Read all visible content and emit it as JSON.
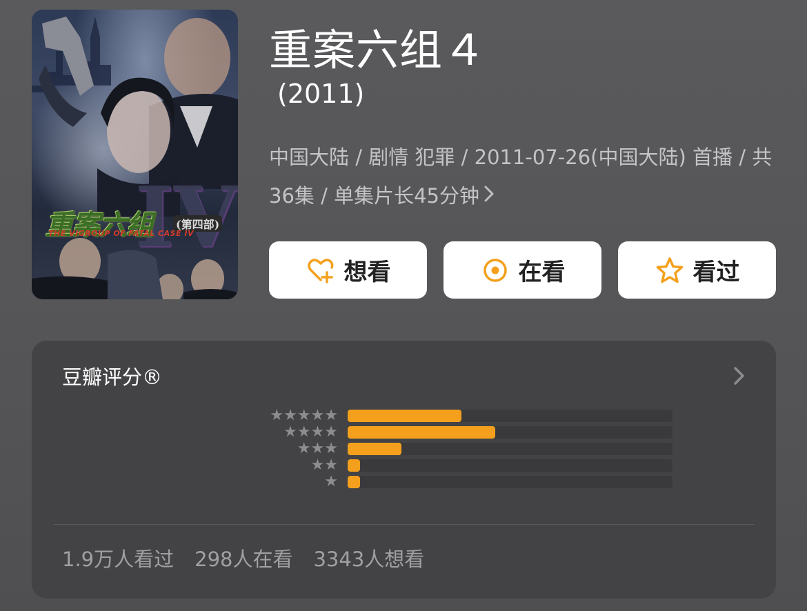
{
  "poster": {
    "title_cn": "重案六组",
    "title_part": "(第四部)",
    "title_en": "THE VIGROUP OF FATAL CASE IV",
    "roman_numeral": "IV"
  },
  "header": {
    "title": "重案六组４",
    "year": "(2011)",
    "meta": "中国大陆 / 剧情 犯罪 / 2011-07-26(中国大陆) 首播 / 共36集 / 单集片长45分钟"
  },
  "actions": {
    "want_label": "想看",
    "watching_label": "在看",
    "watched_label": "看过",
    "accent_color": "#f4a01d"
  },
  "rating": {
    "title": "豆瓣评分®",
    "distribution": [
      {
        "stars": 5,
        "fraction": 0.35
      },
      {
        "stars": 4,
        "fraction": 0.455
      },
      {
        "stars": 3,
        "fraction": 0.165
      },
      {
        "stars": 2,
        "fraction": 0.035
      },
      {
        "stars": 1,
        "fraction": 0.035
      }
    ],
    "bar_color": "#f4a01d"
  },
  "stats": {
    "watched": "1.9万人看过",
    "watching": "298人在看",
    "want": "3343人想看"
  }
}
